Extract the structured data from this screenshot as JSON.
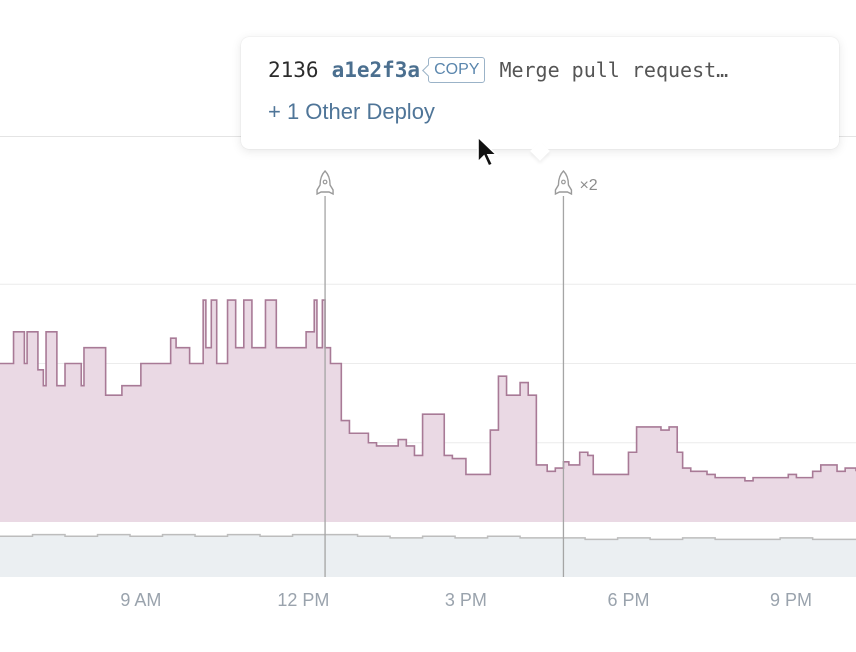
{
  "tooltip": {
    "deploy_id": "2136",
    "commit_hash": "a1e2f3a",
    "copy_label": "COPY",
    "message": "Merge pull request…",
    "other_deploys": "+ 1 Other Deploy"
  },
  "deploy_markers": [
    {
      "x": 12.4,
      "count_label": ""
    },
    {
      "x": 16.8,
      "count_label": "×2"
    }
  ],
  "chart_data": {
    "type": "area",
    "xaxis": {
      "ticks": [
        9,
        12,
        15,
        18,
        21
      ],
      "tick_labels": [
        "9 AM",
        "12 PM",
        "3 PM",
        "6 PM",
        "9 PM"
      ],
      "range": [
        6.4,
        22.2
      ]
    },
    "yaxis": {
      "range": [
        0,
        100
      ],
      "labels": "none",
      "grid": true
    },
    "series": [
      {
        "color": "#a87a96",
        "fill": "#ead9e4",
        "x": [
          6.4,
          6.65,
          6.7,
          6.85,
          6.9,
          7.05,
          7.1,
          7.2,
          7.25,
          7.4,
          7.45,
          7.6,
          7.7,
          7.9,
          7.95,
          8.3,
          8.35,
          8.6,
          8.65,
          8.9,
          9.0,
          9.4,
          9.55,
          9.65,
          9.9,
          10.0,
          10.15,
          10.2,
          10.3,
          10.4,
          10.5,
          10.6,
          10.75,
          10.9,
          11.05,
          11.2,
          11.3,
          11.5,
          11.65,
          11.8,
          12.05,
          12.2,
          12.25,
          12.35,
          12.4,
          12.5,
          12.6,
          12.7,
          12.85,
          13.05,
          13.2,
          13.35,
          13.65,
          13.75,
          13.9,
          14.05,
          14.2,
          14.35,
          14.6,
          14.75,
          15.0,
          15.25,
          15.45,
          15.6,
          15.75,
          15.9,
          16.0,
          16.15,
          16.3,
          16.4,
          16.5,
          16.65,
          16.8,
          16.9,
          17.1,
          17.25,
          17.35,
          17.45,
          17.6,
          17.75,
          17.9,
          18.0,
          18.15,
          18.6,
          18.75,
          18.9,
          19.0,
          19.15,
          19.3,
          19.45,
          19.6,
          19.75,
          19.9,
          20.0,
          20.15,
          20.3,
          20.45,
          20.6,
          20.75,
          20.95,
          21.1,
          21.25,
          21.4,
          21.55,
          21.65,
          21.85,
          22.0,
          22.2
        ],
        "y": [
          50,
          60,
          60,
          50,
          60,
          60,
          48,
          43,
          60,
          60,
          43,
          50,
          50,
          43,
          55,
          55,
          40,
          40,
          43,
          43,
          50,
          50,
          58,
          55,
          50,
          50,
          70,
          55,
          70,
          50,
          50,
          70,
          55,
          70,
          55,
          55,
          70,
          55,
          55,
          55,
          60,
          70,
          55,
          70,
          55,
          50,
          50,
          32,
          28,
          28,
          25,
          24,
          24,
          26,
          24,
          21,
          34,
          34,
          21,
          20,
          15,
          15,
          29,
          46,
          40,
          40,
          44,
          40,
          18,
          18,
          16,
          17,
          19,
          18,
          22,
          21,
          15,
          15,
          15,
          15,
          15,
          22,
          30,
          29,
          30,
          22,
          17,
          16,
          16,
          15,
          14,
          14,
          14,
          14,
          13,
          14,
          14,
          14,
          14,
          15,
          14,
          14,
          16,
          18,
          18,
          16,
          17,
          16
        ]
      },
      {
        "color": "#1ea7c0",
        "fill": "#c4ecf1",
        "x": [
          6.4,
          7.0,
          7.6,
          8.2,
          8.8,
          9.4,
          10.0,
          10.6,
          11.2,
          11.8,
          12.4,
          13.0,
          13.6,
          14.2,
          14.8,
          15.4,
          16.0,
          16.6,
          17.2,
          17.8,
          18.4,
          19.0,
          19.6,
          20.2,
          20.8,
          21.4,
          22.2
        ],
        "y": [
          2.5,
          3,
          2.5,
          3,
          2.5,
          3,
          2.5,
          3,
          3,
          2.5,
          3.5,
          2.5,
          2.5,
          3,
          2.5,
          3,
          2.5,
          2.5,
          2,
          2.5,
          2,
          2.5,
          2,
          2,
          2.5,
          2,
          2
        ]
      },
      {
        "color": "#bdbdbd",
        "fill": "#ebeff2",
        "x": [
          6.4,
          7.0,
          7.6,
          8.2,
          8.8,
          9.4,
          10.0,
          10.6,
          11.2,
          11.8,
          12.4,
          13.0,
          13.6,
          14.2,
          14.8,
          15.4,
          16.0,
          16.6,
          17.2,
          17.8,
          18.4,
          19.0,
          19.6,
          20.2,
          20.8,
          21.4,
          22.2
        ],
        "y": [
          -4.5,
          -4,
          -4.5,
          -4,
          -4.5,
          -4,
          -4.5,
          -4,
          -4.5,
          -4,
          -4,
          -4.5,
          -5,
          -4.5,
          -5,
          -4.5,
          -5,
          -5,
          -5.5,
          -5,
          -5.5,
          -5,
          -5.5,
          -5.5,
          -5,
          -5.5,
          -5.5
        ]
      }
    ]
  }
}
